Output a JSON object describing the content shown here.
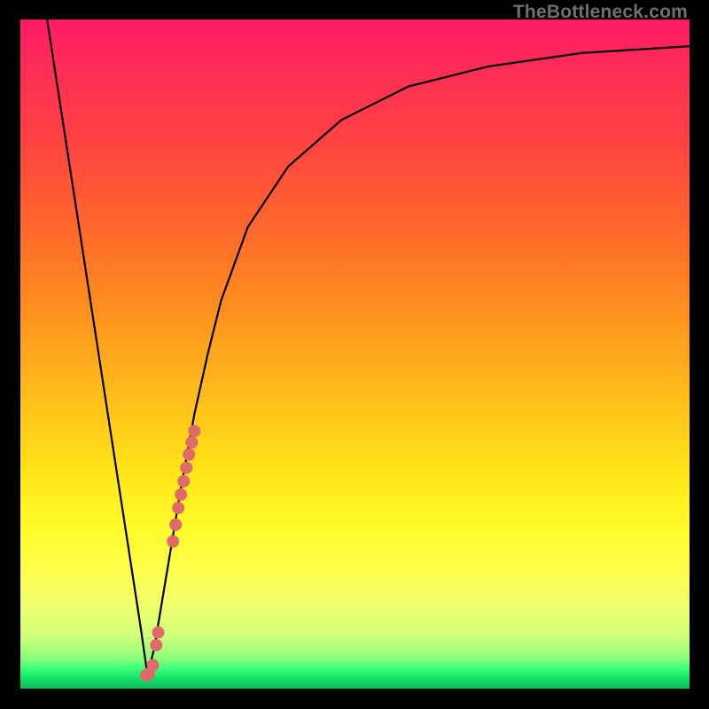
{
  "watermark": "TheBottleneck.com",
  "chart_data": {
    "type": "line",
    "title": "",
    "xlabel": "",
    "ylabel": "",
    "xlim": [
      0,
      100
    ],
    "ylim": [
      0,
      100
    ],
    "series": [
      {
        "name": "bottleneck-curve",
        "x": [
          4,
          6,
          8,
          10,
          12,
          14,
          16,
          18,
          19,
          20,
          22,
          24,
          26,
          28,
          30,
          34,
          40,
          48,
          58,
          70,
          84,
          100
        ],
        "y": [
          100,
          87,
          74,
          61,
          48,
          35,
          22,
          9,
          2,
          6,
          18,
          30,
          41,
          50,
          58,
          69,
          78,
          85,
          90,
          93,
          95,
          96
        ]
      }
    ],
    "markers": [
      {
        "name": "highlight-dots",
        "color": "#e06a6a",
        "points": [
          {
            "x": 18.8,
            "y": 2.0
          },
          {
            "x": 19.2,
            "y": 2.2
          },
          {
            "x": 19.8,
            "y": 3.5
          },
          {
            "x": 20.3,
            "y": 6.5
          },
          {
            "x": 20.6,
            "y": 8.4
          },
          {
            "x": 22.8,
            "y": 22.0
          },
          {
            "x": 23.2,
            "y": 24.5
          },
          {
            "x": 23.6,
            "y": 27.0
          },
          {
            "x": 24.0,
            "y": 29.0
          },
          {
            "x": 24.4,
            "y": 31.0
          },
          {
            "x": 24.8,
            "y": 33.0
          },
          {
            "x": 25.2,
            "y": 35.0
          },
          {
            "x": 25.6,
            "y": 36.8
          },
          {
            "x": 26.0,
            "y": 38.5
          }
        ]
      }
    ]
  }
}
